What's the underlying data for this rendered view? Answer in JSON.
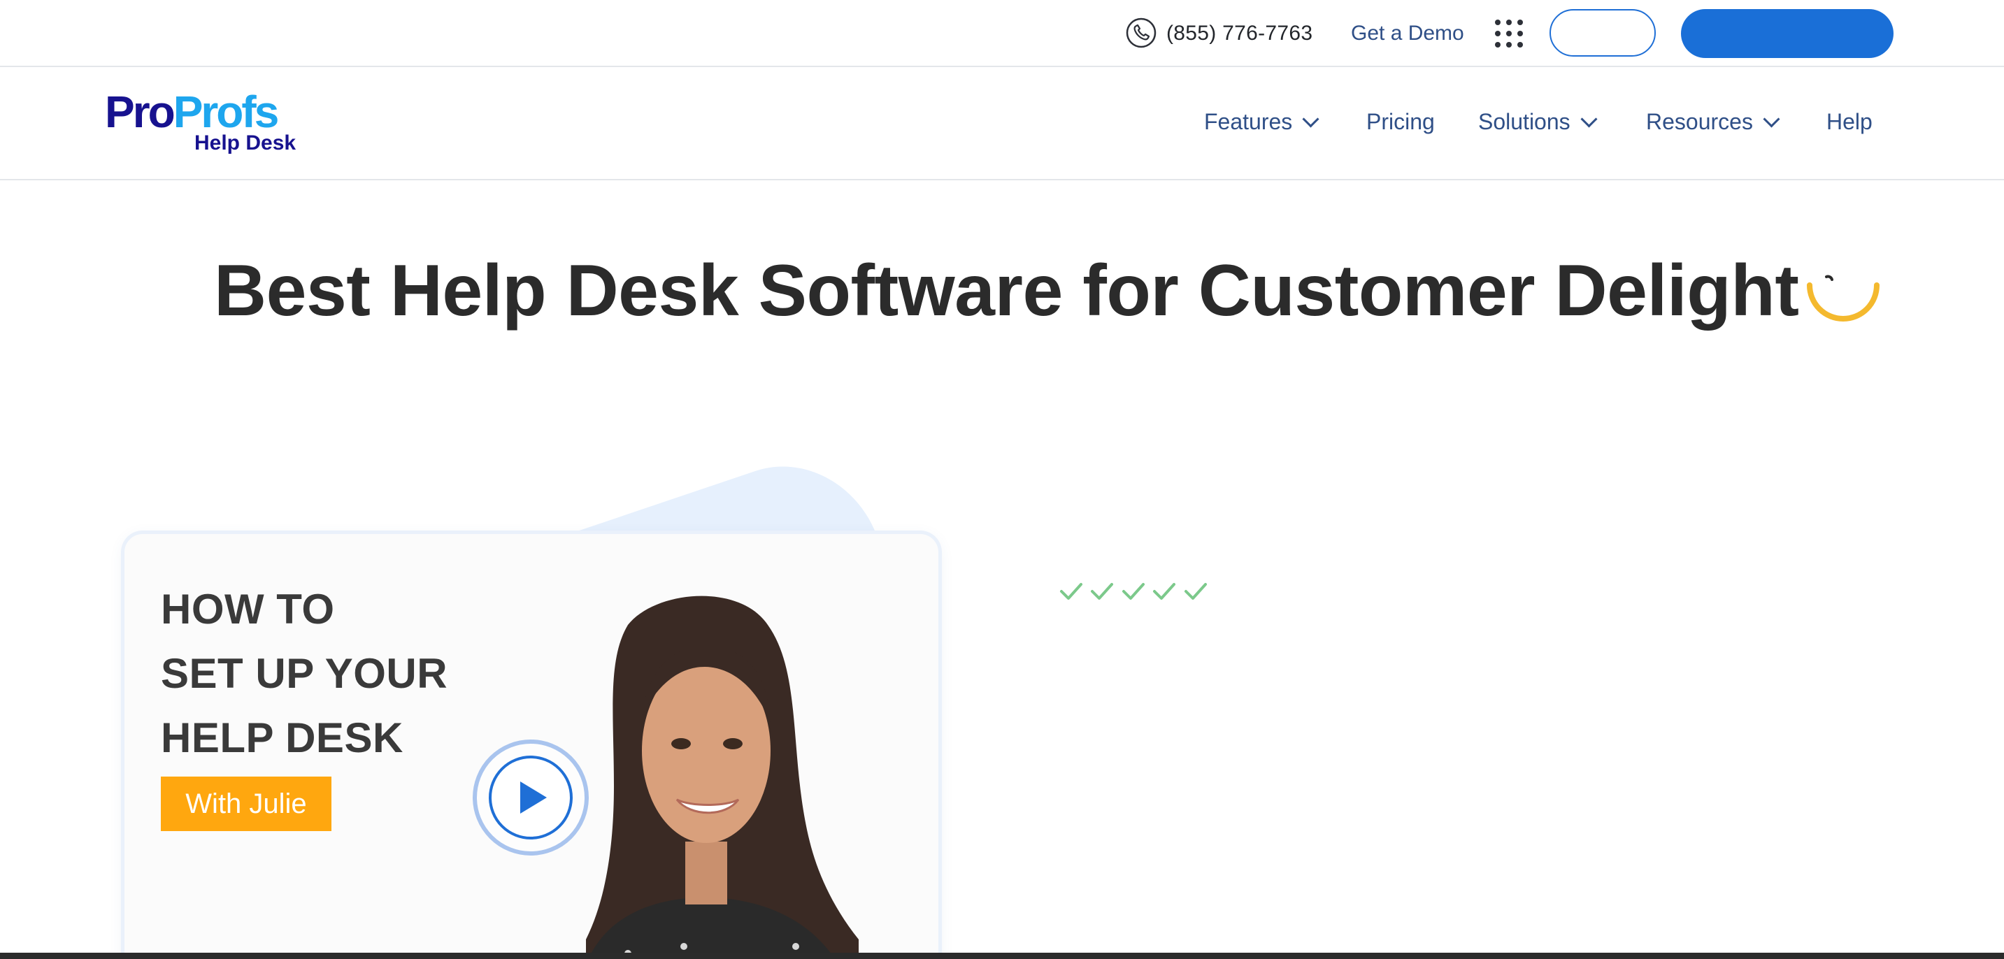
{
  "topbar": {
    "phone": "(855) 776-7763",
    "demo_label": "Get a Demo",
    "login_label": "",
    "signup_label": ""
  },
  "logo": {
    "part1": "Pro",
    "part2": "Profs",
    "sub": "Help Desk"
  },
  "nav": {
    "items": [
      {
        "label": "Features",
        "has_dropdown": true
      },
      {
        "label": "Pricing",
        "has_dropdown": false
      },
      {
        "label": "Solutions",
        "has_dropdown": true
      },
      {
        "label": "Resources",
        "has_dropdown": true
      },
      {
        "label": "Help",
        "has_dropdown": false
      }
    ]
  },
  "hero": {
    "title": "Best Help Desk Software for Customer Delight",
    "video": {
      "title_lines": [
        "HOW TO",
        "SET UP YOUR",
        "HELP DESK"
      ],
      "badge": "With Julie"
    },
    "check_count": 5
  },
  "colors": {
    "brand_blue": "#1a6fd7",
    "nav_text": "#2f4f87",
    "logo_dark": "#17128f",
    "logo_light": "#1ea6ee",
    "badge_orange": "#ffa70f",
    "spinner_yellow": "#f4b92e",
    "check_green": "#7cc98b"
  },
  "icons": [
    "phone-icon",
    "apps-grid-icon",
    "chevron-down-icon",
    "loading-spinner-icon",
    "play-icon",
    "check-icon"
  ]
}
